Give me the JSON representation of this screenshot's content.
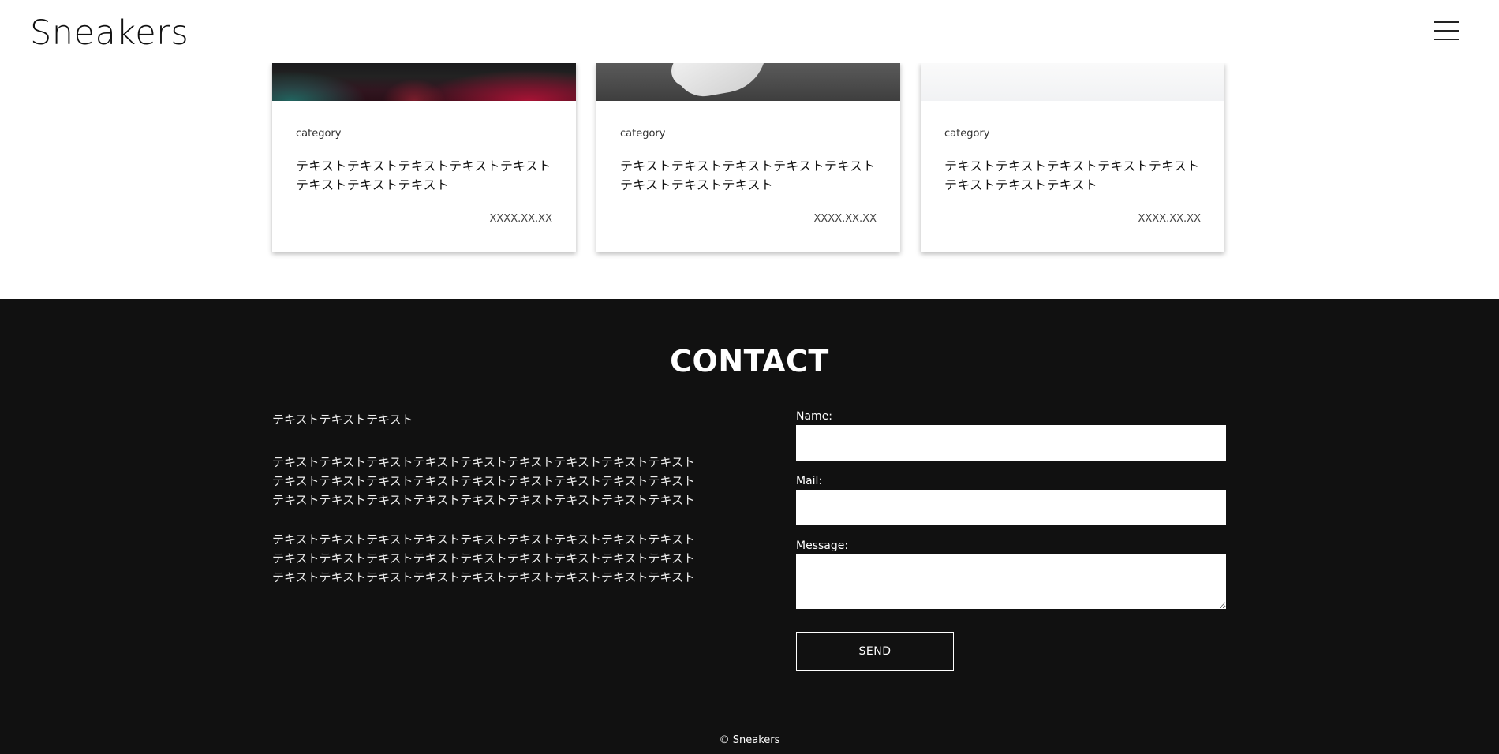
{
  "header": {
    "logo": "Sneakers",
    "menu_icon": "hamburger-menu-icon"
  },
  "cards": [
    {
      "category": "category",
      "title": "テキストテキストテキストテキストテキストテキストテキストテキスト",
      "date": "XXXX.XX.XX"
    },
    {
      "category": "category",
      "title": "テキストテキストテキストテキストテキストテキストテキストテキスト",
      "date": "XXXX.XX.XX"
    },
    {
      "category": "category",
      "title": "テキストテキストテキストテキストテキストテキストテキストテキスト",
      "date": "XXXX.XX.XX"
    }
  ],
  "contact": {
    "title": "CONTACT",
    "paragraphs": [
      "テキストテキストテキスト",
      "テキストテキストテキストテキストテキストテキストテキストテキストテキスト テキストテキストテキストテキストテキストテキストテキストテキストテキスト テキストテキストテキストテキストテキストテキストテキストテキストテキスト",
      "テキストテキストテキストテキストテキストテキストテキストテキストテキスト テキストテキストテキストテキストテキストテキストテキストテキストテキスト テキストテキストテキストテキストテキストテキストテキストテキストテキスト"
    ],
    "form": {
      "name_label": "Name:",
      "name_value": "",
      "mail_label": "Mail:",
      "mail_value": "",
      "message_label": "Message:",
      "message_value": "",
      "send_label": "SEND"
    }
  },
  "footer": {
    "copyright": "© Sneakers"
  },
  "colors": {
    "contact_bg": "#111111",
    "page_bg": "#ffffff"
  }
}
